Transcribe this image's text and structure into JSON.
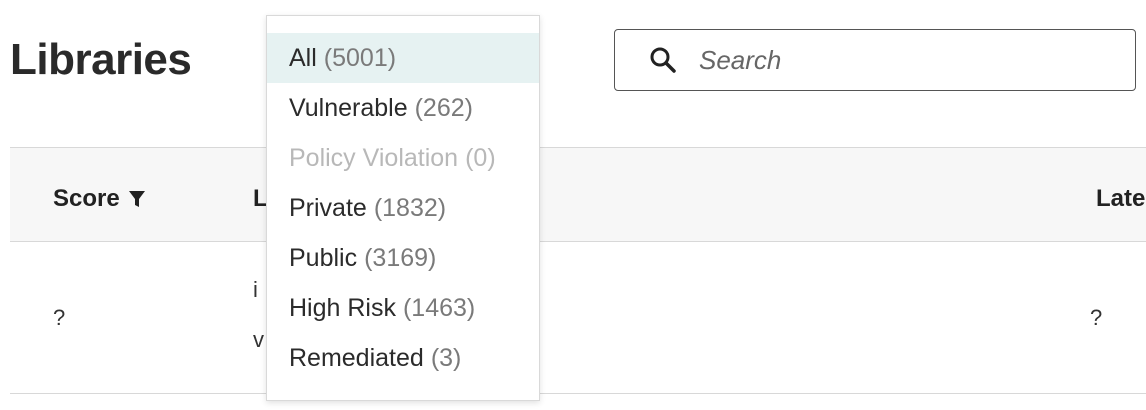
{
  "page": {
    "title": "Libraries"
  },
  "search": {
    "placeholder": "Search",
    "icon": "search-icon"
  },
  "table": {
    "headers": {
      "score": "Score",
      "library_partial": "L",
      "latest_partial": "Late"
    },
    "filter_icon": "filter-icon",
    "rows": [
      {
        "score": "?",
        "library_line1_partial": "i",
        "library_line2_partial": "v",
        "latest": "?"
      }
    ]
  },
  "filter_dropdown": {
    "items": [
      {
        "label": "All",
        "count": "(5001)",
        "selected": true,
        "disabled": false
      },
      {
        "label": "Vulnerable",
        "count": "(262)",
        "selected": false,
        "disabled": false
      },
      {
        "label": "Policy Violation",
        "count": "(0)",
        "selected": false,
        "disabled": true
      },
      {
        "label": "Private",
        "count": "(1832)",
        "selected": false,
        "disabled": false
      },
      {
        "label": "Public",
        "count": "(3169)",
        "selected": false,
        "disabled": false
      },
      {
        "label": "High Risk",
        "count": "(1463)",
        "selected": false,
        "disabled": false
      },
      {
        "label": "Remediated",
        "count": "(3)",
        "selected": false,
        "disabled": false
      }
    ]
  },
  "colors": {
    "selected_bg": "#e6f2f2",
    "disabled_text": "#b8b8b8",
    "header_bg": "#f7f7f7"
  }
}
